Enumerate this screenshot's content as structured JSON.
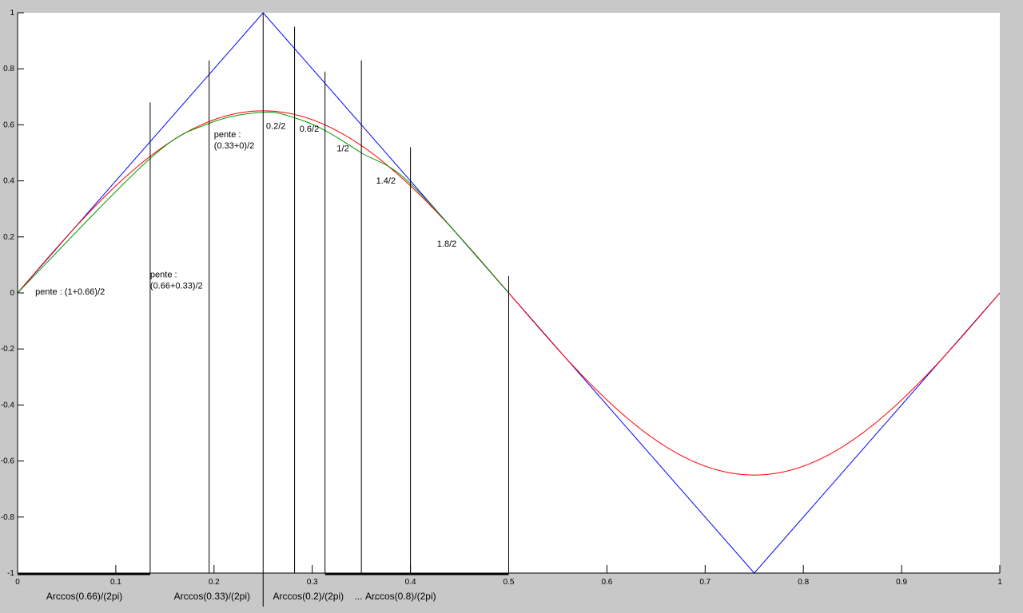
{
  "chart_data": {
    "type": "line",
    "xlim": [
      0,
      1
    ],
    "ylim": [
      -1,
      1
    ],
    "grid": false,
    "x_ticks": [
      0,
      0.1,
      0.2,
      0.3,
      0.4,
      0.5,
      0.6,
      0.7,
      0.8,
      0.9,
      1
    ],
    "x_tick_labels": [
      "0",
      "0.1",
      "0.2",
      "0.3",
      "0.4",
      "0.5",
      "0.6",
      "0.7",
      "0.8",
      "0.9",
      "1"
    ],
    "y_ticks": [
      -1,
      -0.8,
      -0.6,
      -0.4,
      -0.2,
      0,
      0.2,
      0.4,
      0.6,
      0.8,
      1
    ],
    "y_tick_labels": [
      "-1",
      "-0.8",
      "-0.6",
      "-0.4",
      "-0.2",
      "0",
      "0.2",
      "0.4",
      "0.6",
      "0.8",
      "1"
    ],
    "colors": {
      "triangle": "#0000ff",
      "sine": "#ff0000",
      "approx": "#009900",
      "annotation": "#000000"
    },
    "series": [
      {
        "color": "#0000ff",
        "x": [
          0,
          0.25,
          0.75,
          1
        ],
        "y": [
          0,
          1,
          -1,
          0
        ]
      },
      {
        "color": "#ff0000",
        "function": "0.65*sin(2*pi*x)",
        "amplitude": 0.65,
        "x_range": [
          0,
          1
        ]
      },
      {
        "color": "#009900",
        "x": [
          0,
          0.135,
          0.195,
          0.25,
          0.282,
          0.313,
          0.35,
          0.4,
          0.5
        ],
        "y": [
          0,
          0.48,
          0.605,
          0.645,
          0.625,
          0.58,
          0.5,
          0.39,
          0
        ]
      }
    ],
    "vertical_lines": [
      {
        "x": 0.135,
        "y_top": 0.68
      },
      {
        "x": 0.195,
        "y_top": 0.83
      },
      {
        "x": 0.25,
        "y_top": 1.0
      },
      {
        "x": 0.282,
        "y_top": 0.95
      },
      {
        "x": 0.313,
        "y_top": 0.79
      },
      {
        "x": 0.35,
        "y_top": 0.83
      },
      {
        "x": 0.4,
        "y_top": 0.52
      },
      {
        "x": 0.5,
        "y_top": 0.06
      }
    ],
    "bottom_bars": [
      {
        "x0": 0,
        "x1": 0.135
      },
      {
        "x0": 0.313,
        "x1": 0.35
      },
      {
        "x0": 0.35,
        "x1": 0.5
      }
    ],
    "annotations": [
      {
        "text": "pente : (1+0.66)/2",
        "x": 0.018,
        "y": -0.005
      },
      {
        "text": "pente :",
        "x": 0.135,
        "y": 0.055
      },
      {
        "text": "(0.66+0.33)/2",
        "x": 0.135,
        "y": 0.015
      },
      {
        "text": "pente :",
        "x": 0.2,
        "y": 0.555
      },
      {
        "text": "(0.33+0)/2",
        "x": 0.2,
        "y": 0.515
      },
      {
        "text": "0.2/2",
        "x": 0.253,
        "y": 0.585
      },
      {
        "text": "0.6/2",
        "x": 0.287,
        "y": 0.575
      },
      {
        "text": "1/2",
        "x": 0.325,
        "y": 0.505
      },
      {
        "text": "1.4/2",
        "x": 0.365,
        "y": 0.39
      },
      {
        "text": "1.8/2",
        "x": 0.427,
        "y": 0.165
      }
    ],
    "x_annotations": [
      {
        "text": "Arccos(0.66)/(2pi)",
        "x": 0.068
      },
      {
        "text": "Arccos(0.33)/(2pi)",
        "x": 0.198
      },
      {
        "text": "Arccos(0.2)/(2pi)",
        "x": 0.296
      },
      {
        "text": "...",
        "x": 0.347
      },
      {
        "text": "...",
        "x": 0.364
      },
      {
        "text": "Arccos(0.8)/(2pi)",
        "x": 0.39
      }
    ]
  }
}
